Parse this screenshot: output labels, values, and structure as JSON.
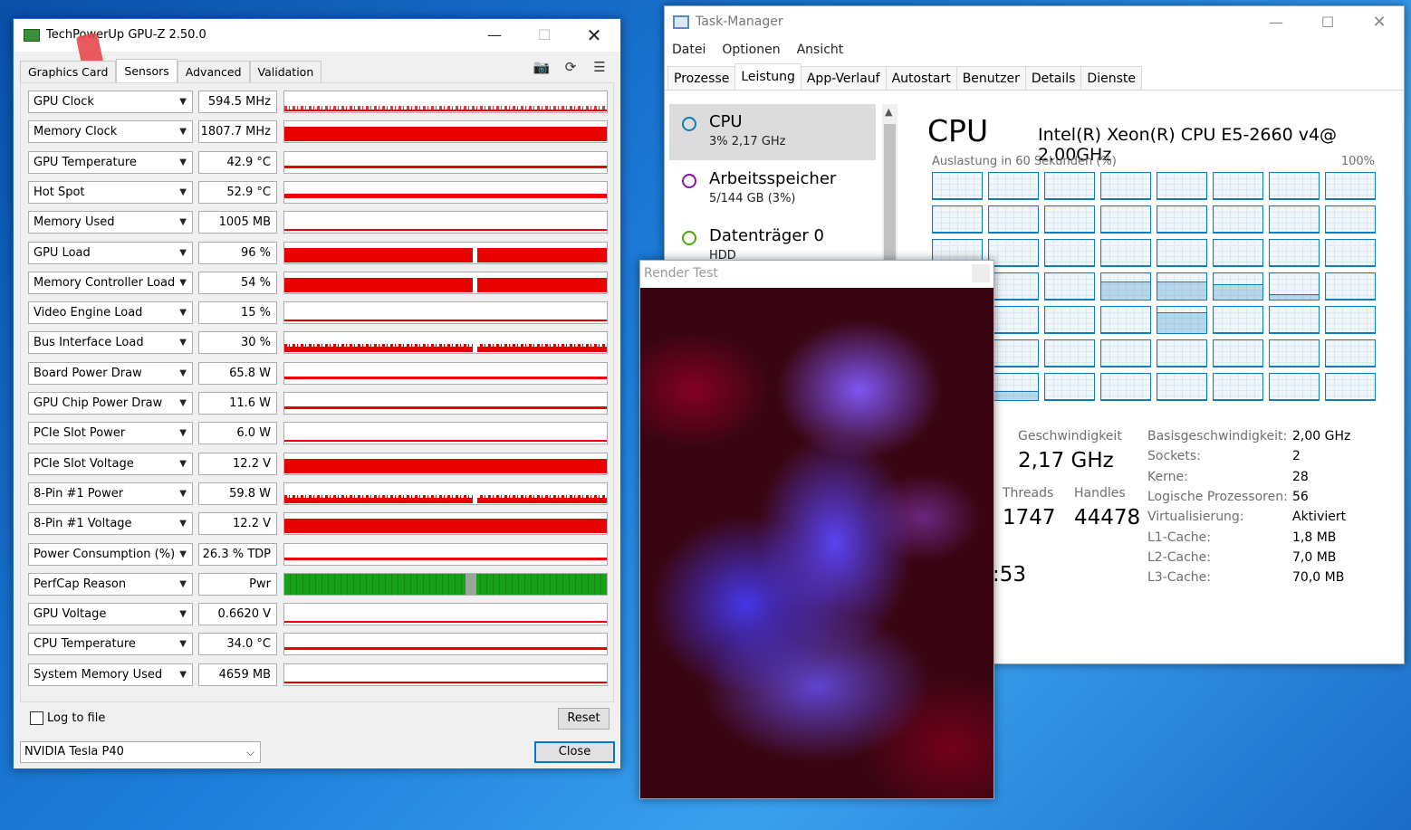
{
  "gpuz": {
    "title": "TechPowerUp GPU-Z 2.50.0",
    "tabs": [
      "Graphics Card",
      "Sensors",
      "Advanced",
      "Validation"
    ],
    "sensors": [
      {
        "name": "GPU Clock",
        "value": "594.5 MHz"
      },
      {
        "name": "Memory Clock",
        "value": "1807.7 MHz"
      },
      {
        "name": "GPU Temperature",
        "value": "42.9 °C"
      },
      {
        "name": "Hot Spot",
        "value": "52.9 °C"
      },
      {
        "name": "Memory Used",
        "value": "1005 MB"
      },
      {
        "name": "GPU Load",
        "value": "96 %"
      },
      {
        "name": "Memory Controller Load",
        "value": "54 %"
      },
      {
        "name": "Video Engine Load",
        "value": "15 %"
      },
      {
        "name": "Bus Interface Load",
        "value": "30 %"
      },
      {
        "name": "Board Power Draw",
        "value": "65.8 W"
      },
      {
        "name": "GPU Chip Power Draw",
        "value": "11.6 W"
      },
      {
        "name": "PCIe Slot Power",
        "value": "6.0 W"
      },
      {
        "name": "PCIe Slot Voltage",
        "value": "12.2 V"
      },
      {
        "name": "8-Pin #1 Power",
        "value": "59.8 W"
      },
      {
        "name": "8-Pin #1 Voltage",
        "value": "12.2 V"
      },
      {
        "name": "Power Consumption (%)",
        "value": "26.3 % TDP"
      },
      {
        "name": "PerfCap Reason",
        "value": "Pwr"
      },
      {
        "name": "GPU Voltage",
        "value": "0.6620 V"
      },
      {
        "name": "CPU Temperature",
        "value": "34.0 °C"
      },
      {
        "name": "System Memory Used",
        "value": "4659 MB"
      }
    ],
    "log_to_file": "Log to file",
    "reset": "Reset",
    "close": "Close",
    "gpu_select": "NVIDIA Tesla P40"
  },
  "taskmanager": {
    "title": "Task-Manager",
    "menu": [
      "Datei",
      "Optionen",
      "Ansicht"
    ],
    "tabs": [
      "Prozesse",
      "Leistung",
      "App-Verlauf",
      "Autostart",
      "Benutzer",
      "Details",
      "Dienste"
    ],
    "sidebar": [
      {
        "name": "CPU",
        "sub": "3% 2,17 GHz"
      },
      {
        "name": "Arbeitsspeicher",
        "sub": "5/144 GB (3%)"
      },
      {
        "name": "Datenträger 0",
        "sub": "HDD"
      }
    ],
    "cpu_heading": "CPU",
    "cpu_model": "Intel(R) Xeon(R) CPU E5-2660 v4@ 2.00GHz",
    "util_label": "Auslastung in 60 Sekunden (%)",
    "util_max": "100%",
    "speed_label": "Geschwindigkeit",
    "speed_value": "2,17 GHz",
    "threads_label": "Threads",
    "threads_value": "1747",
    "handles_label": "Handles",
    "handles_value": "44478",
    "uptime_partial": ":53",
    "specs": [
      {
        "k": "Basisgeschwindigkeit:",
        "v": "2,00 GHz"
      },
      {
        "k": "Sockets:",
        "v": "2"
      },
      {
        "k": "Kerne:",
        "v": "28"
      },
      {
        "k": "Logische Prozessoren:",
        "v": "56"
      },
      {
        "k": "Virtualisierung:",
        "v": "Aktiviert"
      },
      {
        "k": "L1-Cache:",
        "v": "1,8 MB"
      },
      {
        "k": "L2-Cache:",
        "v": "7,0 MB"
      },
      {
        "k": "L3-Cache:",
        "v": "70,0 MB"
      }
    ]
  },
  "render": {
    "title": "Render Test"
  }
}
